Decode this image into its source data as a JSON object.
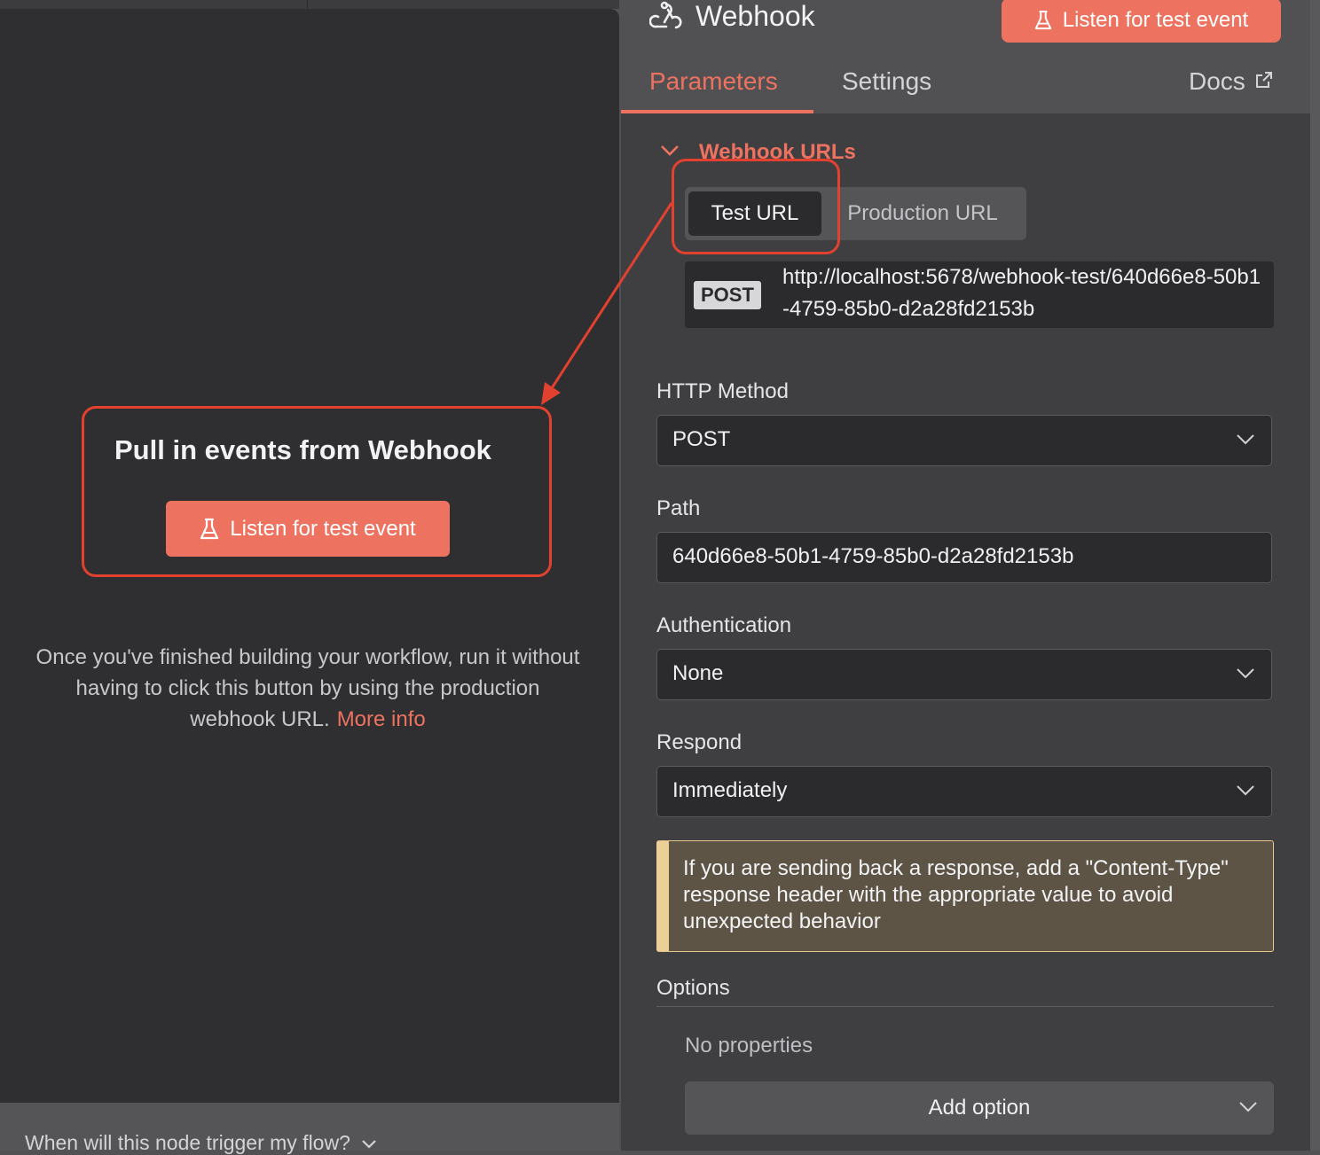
{
  "left": {
    "trigger_title": "Pull in events from Webhook",
    "listen_button": "Listen for test event",
    "info_text": "Once you've finished building your workflow, run it without having to click this button by using the production webhook URL.",
    "more_info_link": "More info",
    "bottom_question": "When will this node trigger my flow?"
  },
  "header": {
    "node_title": "Webhook",
    "listen_button": "Listen for test event",
    "tabs": {
      "parameters": "Parameters",
      "settings": "Settings",
      "docs": "Docs"
    }
  },
  "webhook_urls": {
    "section_title": "Webhook URLs",
    "test_url_tab": "Test URL",
    "production_url_tab": "Production URL",
    "method": "POST",
    "url": "http://localhost:5678/webhook-test/640d66e8-50b1-4759-85b0-d2a28fd2153b"
  },
  "params": {
    "http_method": {
      "label": "HTTP Method",
      "value": "POST"
    },
    "path": {
      "label": "Path",
      "value": "640d66e8-50b1-4759-85b0-d2a28fd2153b"
    },
    "authentication": {
      "label": "Authentication",
      "value": "None"
    },
    "respond": {
      "label": "Respond",
      "value": "Immediately"
    }
  },
  "notice": "If you are sending back a response, add a \"Content-Type\" response header with the appropriate value to avoid unexpected behavior",
  "options": {
    "label": "Options",
    "empty_text": "No properties",
    "add_button": "Add option"
  },
  "colors": {
    "accent": "#ee7260",
    "annotation": "#e2412f",
    "notice_bg": "#5d5446",
    "notice_border": "#eccf96"
  }
}
